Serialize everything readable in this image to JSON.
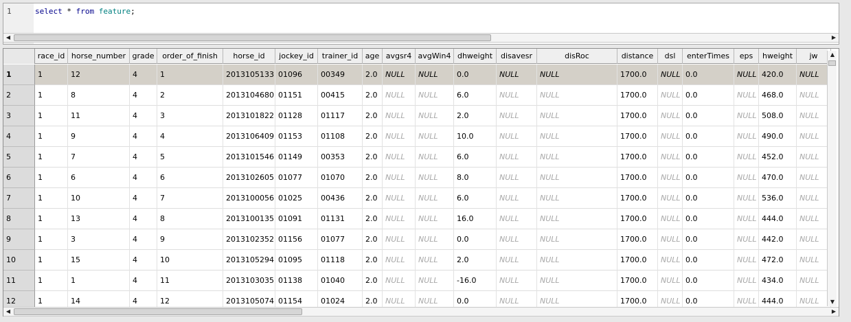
{
  "editor": {
    "line_number": "1",
    "query": {
      "kw1": "select",
      "star": " * ",
      "kw2": "from",
      "table": "feature",
      "end": ";"
    }
  },
  "grid": {
    "columns": [
      "race_id",
      "horse_number",
      "grade",
      "order_of_finish",
      "horse_id",
      "jockey_id",
      "trainer_id",
      "age",
      "avgsr4",
      "avgWin4",
      "dhweight",
      "disavesr",
      "disRoc",
      "distance",
      "dsl",
      "enterTimes",
      "eps",
      "hweight",
      "jw"
    ],
    "rows": [
      {
        "num": "1",
        "cells": [
          "1",
          "12",
          "4",
          "1",
          "2013105133",
          "01096",
          "00349",
          "2.0",
          "NULL",
          "NULL",
          "0.0",
          "NULL",
          "NULL",
          "1700.0",
          "NULL",
          "0.0",
          "NULL",
          "420.0",
          "NULL"
        ]
      },
      {
        "num": "2",
        "cells": [
          "1",
          "8",
          "4",
          "2",
          "2013104680",
          "01151",
          "00415",
          "2.0",
          "NULL",
          "NULL",
          "6.0",
          "NULL",
          "NULL",
          "1700.0",
          "NULL",
          "0.0",
          "NULL",
          "468.0",
          "NULL"
        ]
      },
      {
        "num": "3",
        "cells": [
          "1",
          "11",
          "4",
          "3",
          "2013101822",
          "01128",
          "01117",
          "2.0",
          "NULL",
          "NULL",
          "2.0",
          "NULL",
          "NULL",
          "1700.0",
          "NULL",
          "0.0",
          "NULL",
          "508.0",
          "NULL"
        ]
      },
      {
        "num": "4",
        "cells": [
          "1",
          "9",
          "4",
          "4",
          "2013106409",
          "01153",
          "01108",
          "2.0",
          "NULL",
          "NULL",
          "10.0",
          "NULL",
          "NULL",
          "1700.0",
          "NULL",
          "0.0",
          "NULL",
          "490.0",
          "NULL"
        ]
      },
      {
        "num": "5",
        "cells": [
          "1",
          "7",
          "4",
          "5",
          "2013101546",
          "01149",
          "00353",
          "2.0",
          "NULL",
          "NULL",
          "6.0",
          "NULL",
          "NULL",
          "1700.0",
          "NULL",
          "0.0",
          "NULL",
          "452.0",
          "NULL"
        ]
      },
      {
        "num": "6",
        "cells": [
          "1",
          "6",
          "4",
          "6",
          "2013102605",
          "01077",
          "01070",
          "2.0",
          "NULL",
          "NULL",
          "8.0",
          "NULL",
          "NULL",
          "1700.0",
          "NULL",
          "0.0",
          "NULL",
          "470.0",
          "NULL"
        ]
      },
      {
        "num": "7",
        "cells": [
          "1",
          "10",
          "4",
          "7",
          "2013100056",
          "01025",
          "00436",
          "2.0",
          "NULL",
          "NULL",
          "6.0",
          "NULL",
          "NULL",
          "1700.0",
          "NULL",
          "0.0",
          "NULL",
          "536.0",
          "NULL"
        ]
      },
      {
        "num": "8",
        "cells": [
          "1",
          "13",
          "4",
          "8",
          "2013100135",
          "01091",
          "01131",
          "2.0",
          "NULL",
          "NULL",
          "16.0",
          "NULL",
          "NULL",
          "1700.0",
          "NULL",
          "0.0",
          "NULL",
          "444.0",
          "NULL"
        ]
      },
      {
        "num": "9",
        "cells": [
          "1",
          "3",
          "4",
          "9",
          "2013102352",
          "01156",
          "01077",
          "2.0",
          "NULL",
          "NULL",
          "0.0",
          "NULL",
          "NULL",
          "1700.0",
          "NULL",
          "0.0",
          "NULL",
          "442.0",
          "NULL"
        ]
      },
      {
        "num": "10",
        "cells": [
          "1",
          "15",
          "4",
          "10",
          "2013105294",
          "01095",
          "01118",
          "2.0",
          "NULL",
          "NULL",
          "2.0",
          "NULL",
          "NULL",
          "1700.0",
          "NULL",
          "0.0",
          "NULL",
          "472.0",
          "NULL"
        ]
      },
      {
        "num": "11",
        "cells": [
          "1",
          "1",
          "4",
          "11",
          "2013103035",
          "01138",
          "01040",
          "2.0",
          "NULL",
          "NULL",
          "-16.0",
          "NULL",
          "NULL",
          "1700.0",
          "NULL",
          "0.0",
          "NULL",
          "434.0",
          "NULL"
        ]
      },
      {
        "num": "12",
        "cells": [
          "1",
          "14",
          "4",
          "12",
          "2013105074",
          "01154",
          "01024",
          "2.0",
          "NULL",
          "NULL",
          "0.0",
          "NULL",
          "NULL",
          "1700.0",
          "NULL",
          "0.0",
          "NULL",
          "444.0",
          "NULL"
        ]
      }
    ],
    "selected_row": "1"
  },
  "icons": {
    "left": "◀",
    "right": "▶",
    "up": "▲",
    "down": "▼"
  }
}
